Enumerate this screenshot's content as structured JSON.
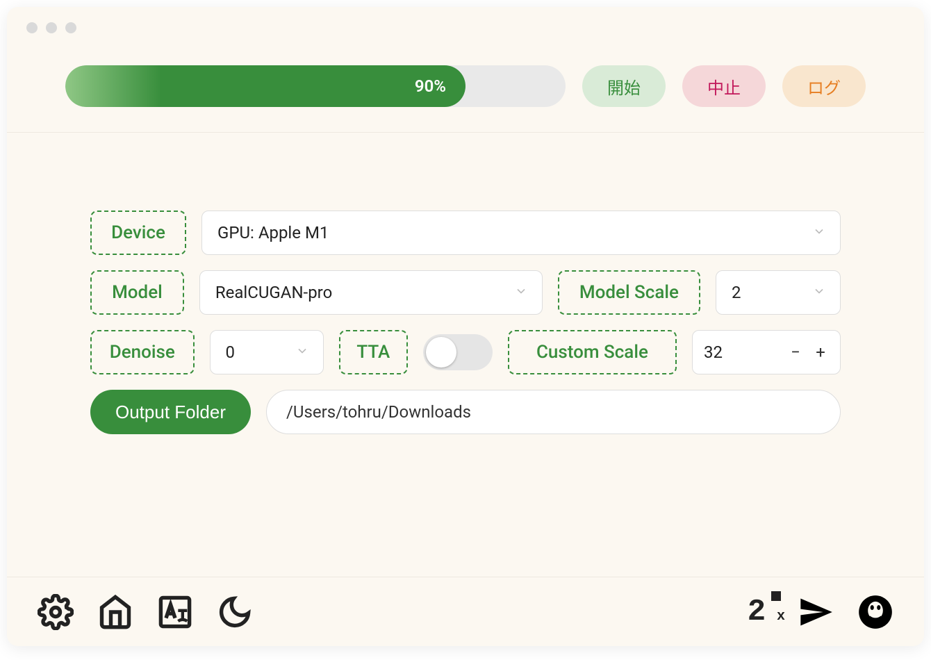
{
  "titlebar": {
    "dots": 3
  },
  "header": {
    "progress_percent": 90,
    "progress_label": "90%",
    "buttons": {
      "start": "開始",
      "stop": "中止",
      "log": "ログ"
    }
  },
  "form": {
    "device": {
      "label": "Device",
      "value": "GPU: Apple M1"
    },
    "model": {
      "label": "Model",
      "value": "RealCUGAN-pro"
    },
    "model_scale": {
      "label": "Model Scale",
      "value": "2"
    },
    "denoise": {
      "label": "Denoise",
      "value": "0"
    },
    "tta": {
      "label": "TTA",
      "enabled": false
    },
    "custom_scale": {
      "label": "Custom Scale",
      "value": "32"
    },
    "output_folder": {
      "button": "Output Folder",
      "value": "/Users/tohru/Downloads"
    }
  },
  "footer_icons": {
    "settings": "settings-icon",
    "home": "home-icon",
    "language": "language-icon",
    "theme": "moon-icon",
    "waifu2x": "waifu2x-icon",
    "send": "send-icon",
    "qq": "qq-icon"
  },
  "colors": {
    "accent_green": "#388E3C",
    "bg": "#FCF8F1",
    "pill_start_bg": "#D9EBD7",
    "pill_stop_bg": "#F5D7D9",
    "pill_stop_text": "#C2185B",
    "pill_log_bg": "#F9E6CE",
    "pill_log_text": "#E67E22"
  }
}
